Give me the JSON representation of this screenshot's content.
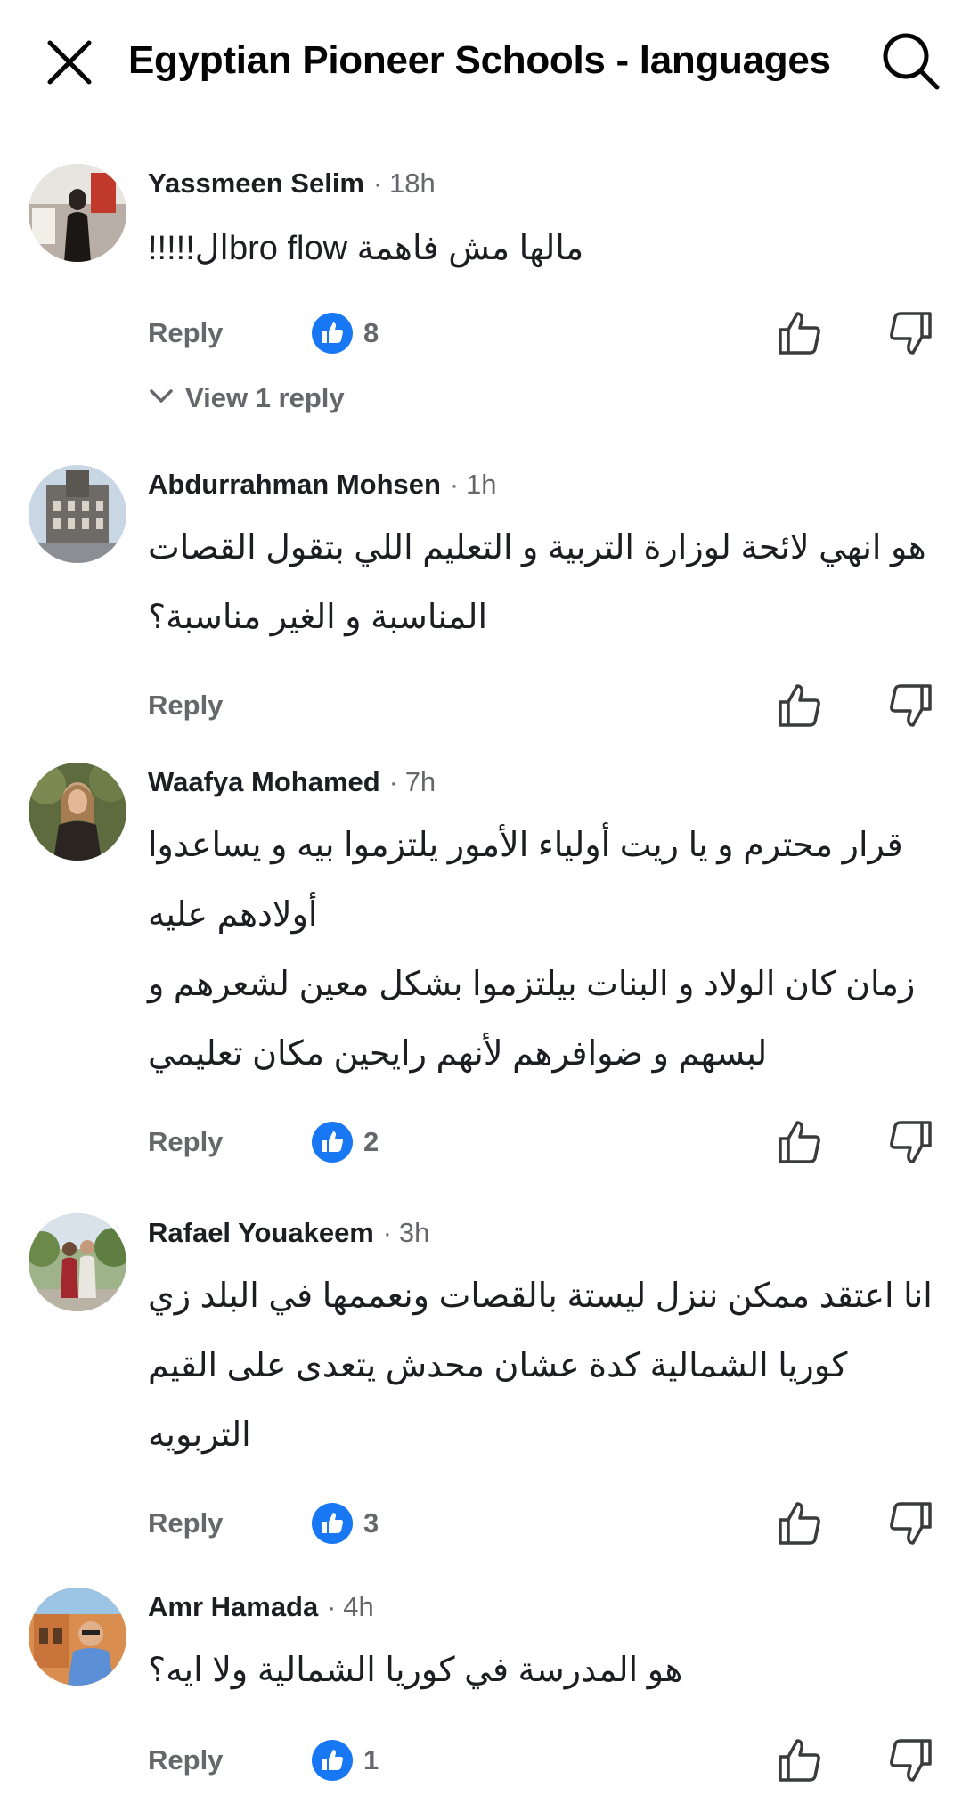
{
  "header": {
    "title": "Egyptian Pioneer Schools - languages",
    "close_icon": "close-icon",
    "search_icon": "search-icon"
  },
  "labels": {
    "reply": "Reply",
    "separator": "·"
  },
  "colors": {
    "like_blue": "#1877f2",
    "secondary_text": "#65676b"
  },
  "comments": [
    {
      "author": "Yassmeen Selim",
      "time": "18h",
      "lines": [
        "!!!!!الbro flow مالها مش فاهمة"
      ],
      "likes": "8",
      "view_replies": "View 1 reply"
    },
    {
      "author": "Abdurrahman Mohsen",
      "time": "1h",
      "lines": [
        "هو انهي لائحة لوزارة التربية و التعليم اللي بتقول القصات",
        "المناسبة و الغير مناسبة؟"
      ],
      "likes": ""
    },
    {
      "author": "Waafya Mohamed",
      "time": "7h",
      "lines": [
        "قرار محترم و يا ريت أولياء الأمور يلتزموا بيه و يساعدوا",
        "أولادهم عليه",
        "زمان كان الولاد و البنات بيلتزموا بشكل معين لشعرهم و",
        "لبسهم و ضوافرهم لأنهم رايحين مكان تعليمي"
      ],
      "likes": "2"
    },
    {
      "author": "Rafael Youakeem",
      "time": "3h",
      "lines": [
        "انا اعتقد ممكن ننزل ليستة بالقصات ونعممها في البلد زي",
        "كوريا الشمالية كدة عشان محدش يتعدى على القيم",
        "التربويه"
      ],
      "likes": "3"
    },
    {
      "author": "Amr Hamada",
      "time": "4h",
      "lines": [
        "هو المدرسة في كوريا الشمالية ولا ايه؟"
      ],
      "likes": "1"
    }
  ]
}
